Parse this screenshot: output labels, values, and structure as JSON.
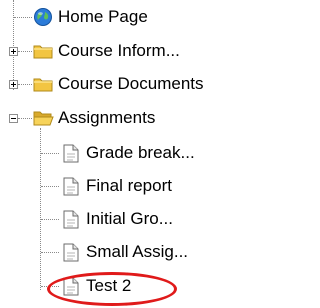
{
  "tree": {
    "home": {
      "label": "Home Page",
      "icon": "globe-icon"
    },
    "course_information": {
      "label": "Course Inform...",
      "icon": "folder-icon",
      "expander": "plus"
    },
    "course_documents": {
      "label": "Course Documents",
      "icon": "folder-icon",
      "expander": "plus"
    },
    "assignments": {
      "label": "Assignments",
      "icon": "open-folder-icon",
      "expander": "minus",
      "children": [
        {
          "label": "Grade break...",
          "icon": "document-icon"
        },
        {
          "label": "Final report",
          "icon": "document-icon"
        },
        {
          "label": "Initial Gro...",
          "icon": "document-icon"
        },
        {
          "label": "Small Assig...",
          "icon": "document-icon"
        },
        {
          "label": "Test 2",
          "icon": "document-icon",
          "highlighted": true
        }
      ]
    }
  },
  "colors": {
    "highlight_ring": "#e01a1a",
    "folder": "#f2c542",
    "connector": "#8a8a8a"
  }
}
